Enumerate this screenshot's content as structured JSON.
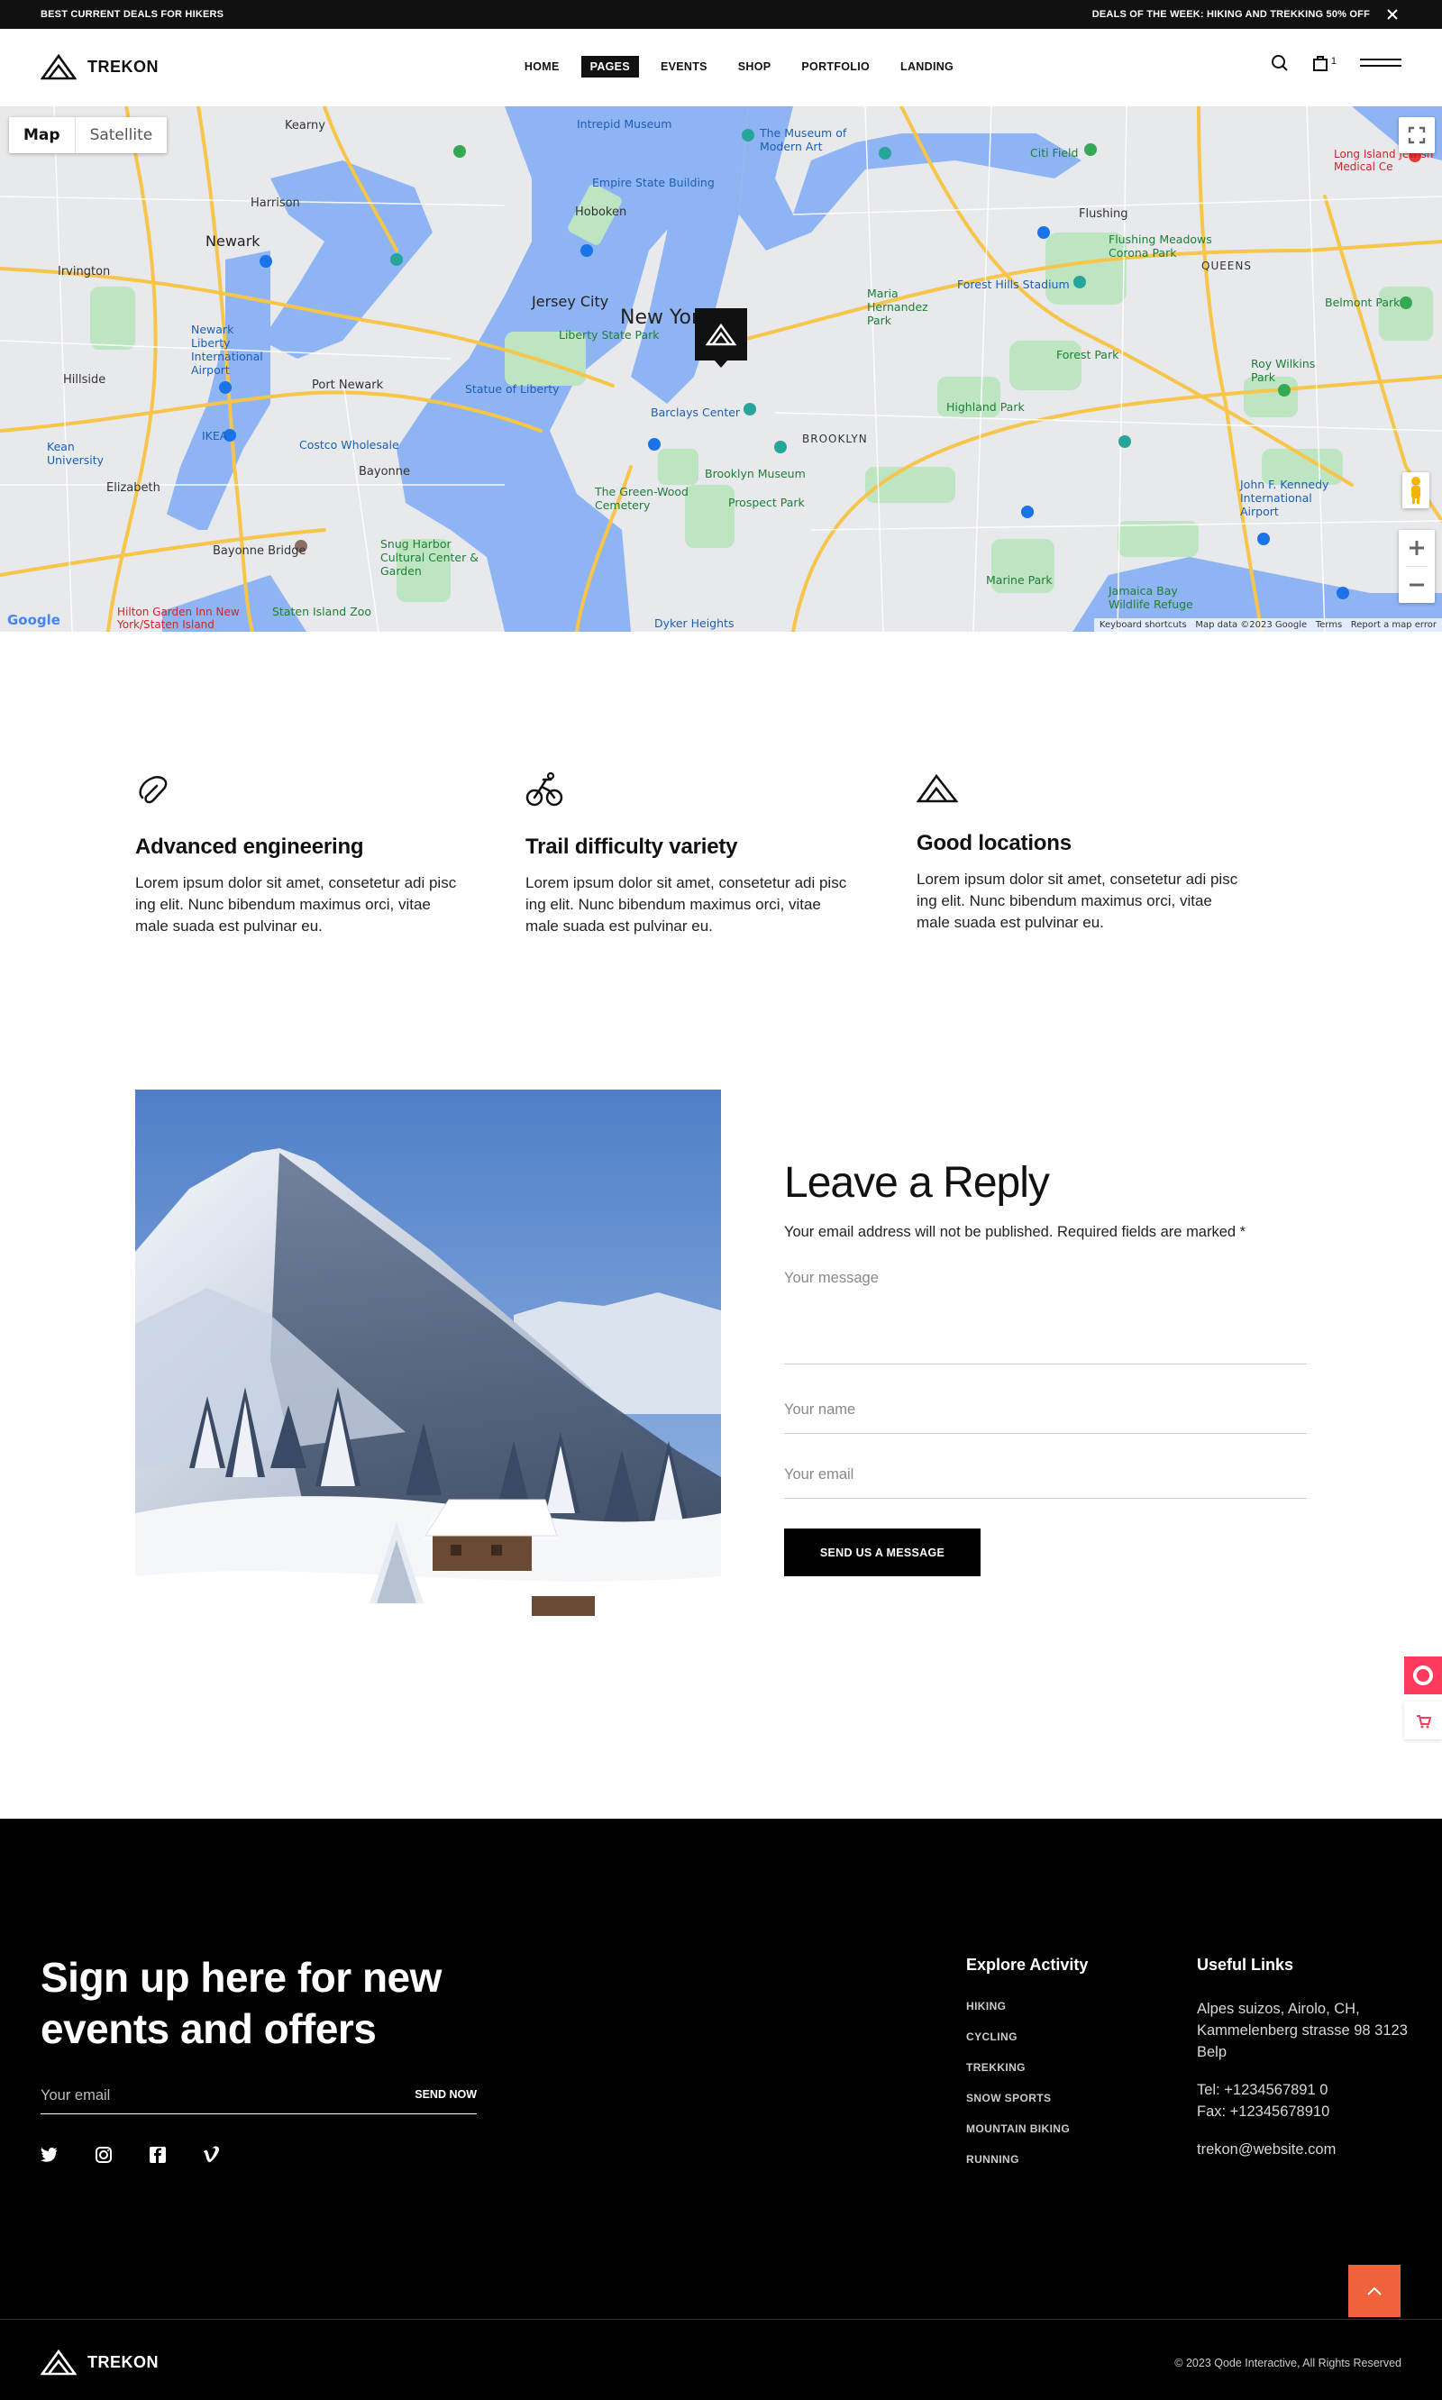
{
  "topbar": {
    "left_text": "BEST CURRENT DEALS FOR HIKERS",
    "right_text": "DEALS OF THE WEEK: HIKING AND TREKKING 50% OFF",
    "close_icon": "close-icon"
  },
  "header": {
    "logo_text": "TREKON",
    "nav": [
      {
        "label": "HOME",
        "active": false
      },
      {
        "label": "PAGES",
        "active": true
      },
      {
        "label": "EVENTS",
        "active": false
      },
      {
        "label": "SHOP",
        "active": false
      },
      {
        "label": "PORTFOLIO",
        "active": false
      },
      {
        "label": "LANDING",
        "active": false
      }
    ],
    "cart_count": "1",
    "icons": [
      "search-icon",
      "shopping-bag-icon",
      "menu-icon"
    ]
  },
  "map": {
    "tab_map": "Map",
    "tab_satellite": "Satellite",
    "google_label": "Google",
    "attribution": [
      "Keyboard shortcuts",
      "Map data ©2023 Google",
      "Terms",
      "Report a map error"
    ],
    "labels": {
      "new_york": "New York",
      "jersey_city": "Jersey City",
      "newark": "Newark",
      "hoboken": "Hoboken",
      "harrison": "Harrison",
      "kearny": "Kearny",
      "irvington": "Irvington",
      "hillside": "Hillside",
      "elizabeth": "Elizabeth",
      "bayonne": "Bayonne",
      "brooklyn": "BROOKLYN",
      "queens": "QUEENS",
      "flushing": "Flushing",
      "bayonne_bridge": "Bayonne Bridge",
      "staten_island_zoo": "Staten Island Zoo",
      "intrepid": "Intrepid Museum",
      "moma": "The Museum of Modern Art",
      "empire_state": "Empire State Building",
      "liberty_park": "Liberty State Park",
      "statue_of_liberty": "Statue of Liberty",
      "newark_airport": "Newark Liberty International Airport",
      "port_newark": "Port Newark",
      "ikea": "IKEA",
      "costco": "Costco Wholesale",
      "barclays": "Barclays Center",
      "brooklyn_museum": "Brooklyn Museum",
      "prospect_park": "Prospect Park",
      "green_wood": "The Green-Wood Cemetery",
      "forest_park": "Forest Park",
      "forest_hills": "Forest Hills Stadium",
      "flushing_meadows": "Flushing Meadows Corona Park",
      "highland_park": "Highland Park",
      "jfk": "John F. Kennedy International Airport",
      "jamaica_bay": "Jamaica Bay Wildlife Refuge",
      "marine_park": "Marine Park",
      "dyker_heights": "Dyker Heights",
      "snug_harbor": "Snug Harbor Cultural Center & Garden",
      "hilton_garden": "Hilton Garden Inn New York/Staten Island",
      "jewish_medical": "Long Island Jewish Medical Ce",
      "belmont_park": "Belmont Park",
      "maria_hernandez": "Maria Hernandez Park",
      "kean_university": "Kean University",
      "roy_wilkins": "Roy Wilkins Park",
      "citi_field": "Citi Field"
    }
  },
  "features": [
    {
      "icon": "paperclip-icon",
      "title": "Advanced engineering",
      "text": "Lorem ipsum dolor sit amet, consetetur adi pisc ing elit. Nunc bibendum maximus orci, vitae male suada est pulvinar eu."
    },
    {
      "icon": "bicycle-icon",
      "title": "Trail difficulty variety",
      "text": "Lorem ipsum dolor sit amet, consetetur adi pisc ing elit. Nunc bibendum maximus orci, vitae male suada est pulvinar eu."
    },
    {
      "icon": "mountain-icon",
      "title": "Good locations",
      "text": "Lorem ipsum dolor sit amet, consetetur adi pisc ing elit. Nunc bibendum maximus orci, vitae male suada est pulvinar eu."
    }
  ],
  "reply": {
    "title": "Leave a Reply",
    "note": "Your email address will not be published. Required fields are marked *",
    "message_placeholder": "Your message",
    "name_placeholder": "Your name",
    "email_placeholder": "Your email",
    "button": "SEND US A MESSAGE"
  },
  "footer": {
    "signup_title": "Sign up here for new events and offers",
    "newsletter_placeholder": "Your email",
    "newsletter_button": "SEND NOW",
    "socials": [
      "twitter-icon",
      "instagram-icon",
      "facebook-icon",
      "vimeo-icon"
    ],
    "explore_title": "Explore Activity",
    "explore_items": [
      "HIKING",
      "CYCLING",
      "TREKKING",
      "SNOW SPORTS",
      "MOUNTAIN BIKING",
      "RUNNING"
    ],
    "useful_title": "Useful Links",
    "address": "Alpes suizos, Airolo, CH, Kammelenberg strasse 98 3123 Belp",
    "tel": "Tel: +1234567891 0",
    "fax": "Fax: +12345678910",
    "email": "trekon@website.com",
    "logo_text": "TREKON",
    "copyright": "© 2023 Qode Interactive, All Rights Reserved"
  },
  "colors": {
    "accent_orange": "#f0623c",
    "widget_pink": "#ff3b5c",
    "water": "#8fb4f4",
    "park": "#bde5c2"
  }
}
